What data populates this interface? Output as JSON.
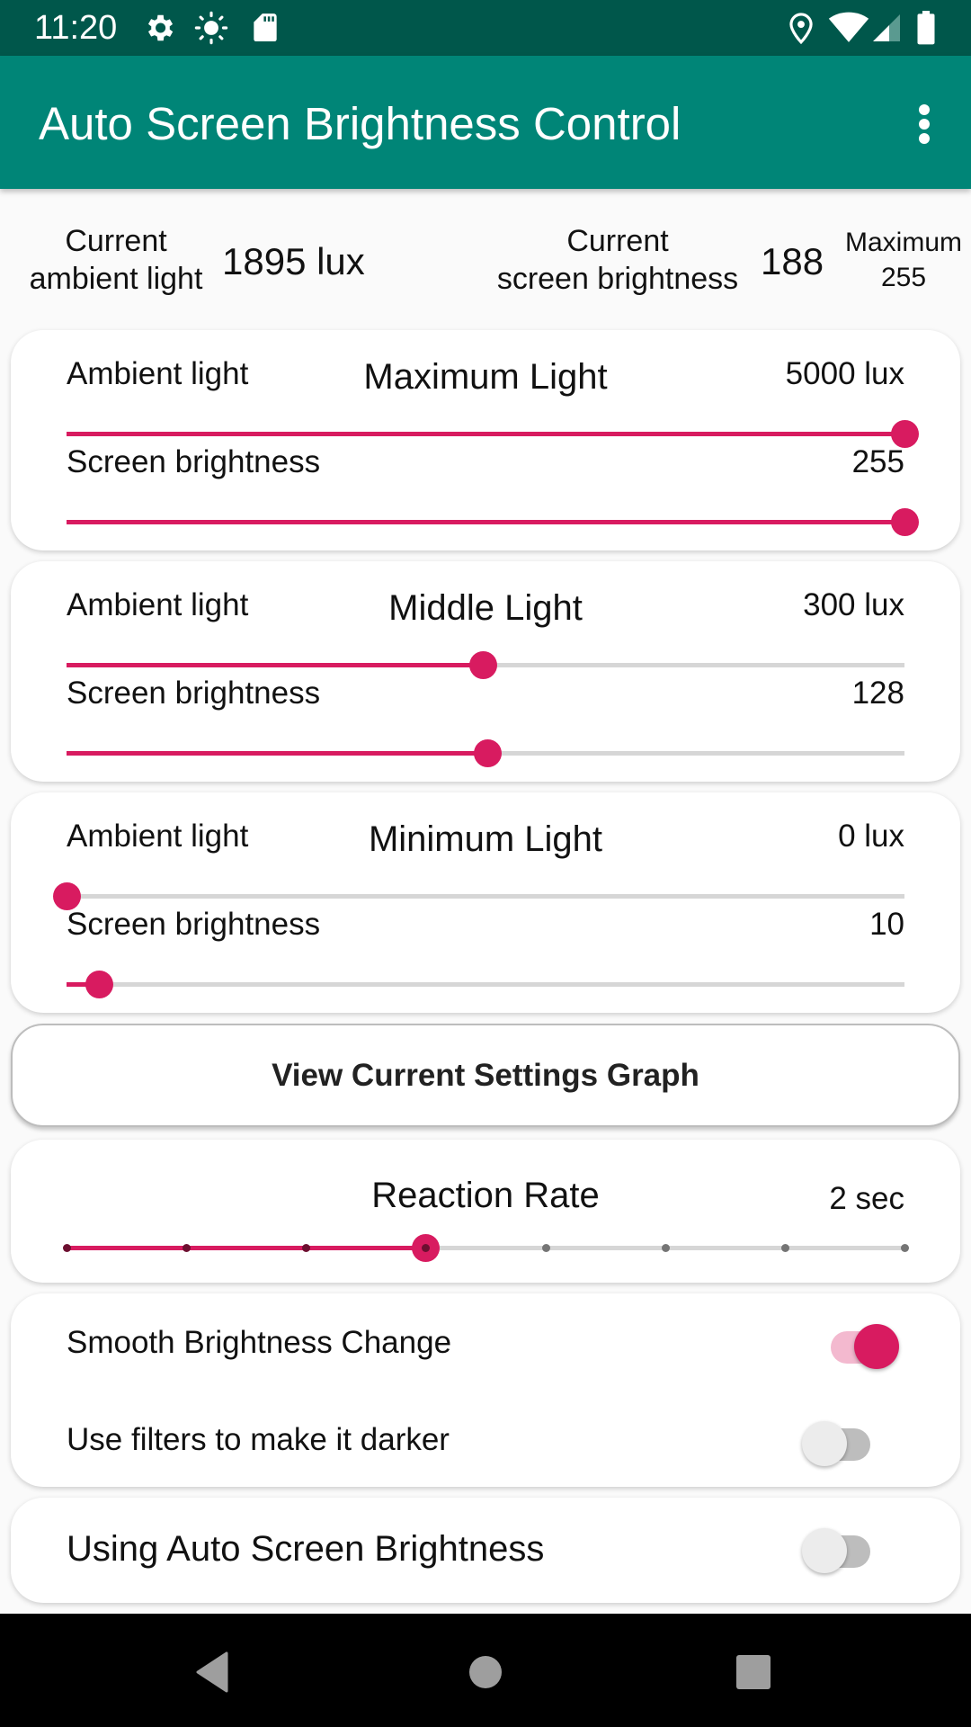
{
  "status_bar": {
    "time": "11:20",
    "left_icons": [
      "gear-icon",
      "brightness-icon",
      "sd-card-icon"
    ],
    "right_icons": [
      "location-icon",
      "wifi-icon",
      "cell-signal-icon",
      "battery-icon"
    ]
  },
  "app_bar": {
    "title": "Auto Screen Brightness Control",
    "overflow_menu": "more-options-icon"
  },
  "info": {
    "ambient_label_line1": "Current",
    "ambient_label_line2": "ambient light",
    "ambient_value": "1895 lux",
    "screen_label_line1": "Current",
    "screen_label_line2": "screen brightness",
    "screen_value": "188",
    "max_label": "Maximum",
    "max_value": "255"
  },
  "cards": [
    {
      "title": "Maximum Light",
      "ambient_label": "Ambient light",
      "ambient_value": "5000 lux",
      "ambient_fraction": 1.0,
      "brightness_label": "Screen brightness",
      "brightness_value": "255",
      "brightness_fraction": 1.0
    },
    {
      "title": "Middle Light",
      "ambient_label": "Ambient light",
      "ambient_value": "300 lux",
      "ambient_fraction": 0.497,
      "brightness_label": "Screen brightness",
      "brightness_value": "128",
      "brightness_fraction": 0.502
    },
    {
      "title": "Minimum Light",
      "ambient_label": "Ambient light",
      "ambient_value": "0 lux",
      "ambient_fraction": 0.0,
      "brightness_label": "Screen brightness",
      "brightness_value": "10",
      "brightness_fraction": 0.039
    }
  ],
  "graph_button": {
    "label": "View Current Settings Graph"
  },
  "reaction_rate": {
    "title": "Reaction Rate",
    "value": "2 sec",
    "steps": 8,
    "selected_index": 3
  },
  "toggles": [
    {
      "label": "Smooth Brightness Change",
      "on": true
    },
    {
      "label": "Use filters to make it darker",
      "on": false
    }
  ],
  "auto_brightness": {
    "label": "Using Auto Screen Brightness",
    "on": false
  },
  "colors": {
    "status_bar": "#00574b",
    "app_bar": "#008577",
    "accent": "#d81b60",
    "track_inactive": "#d6d6d6"
  },
  "nav_bar": {
    "buttons": [
      "back-icon",
      "home-icon",
      "recents-icon"
    ]
  }
}
